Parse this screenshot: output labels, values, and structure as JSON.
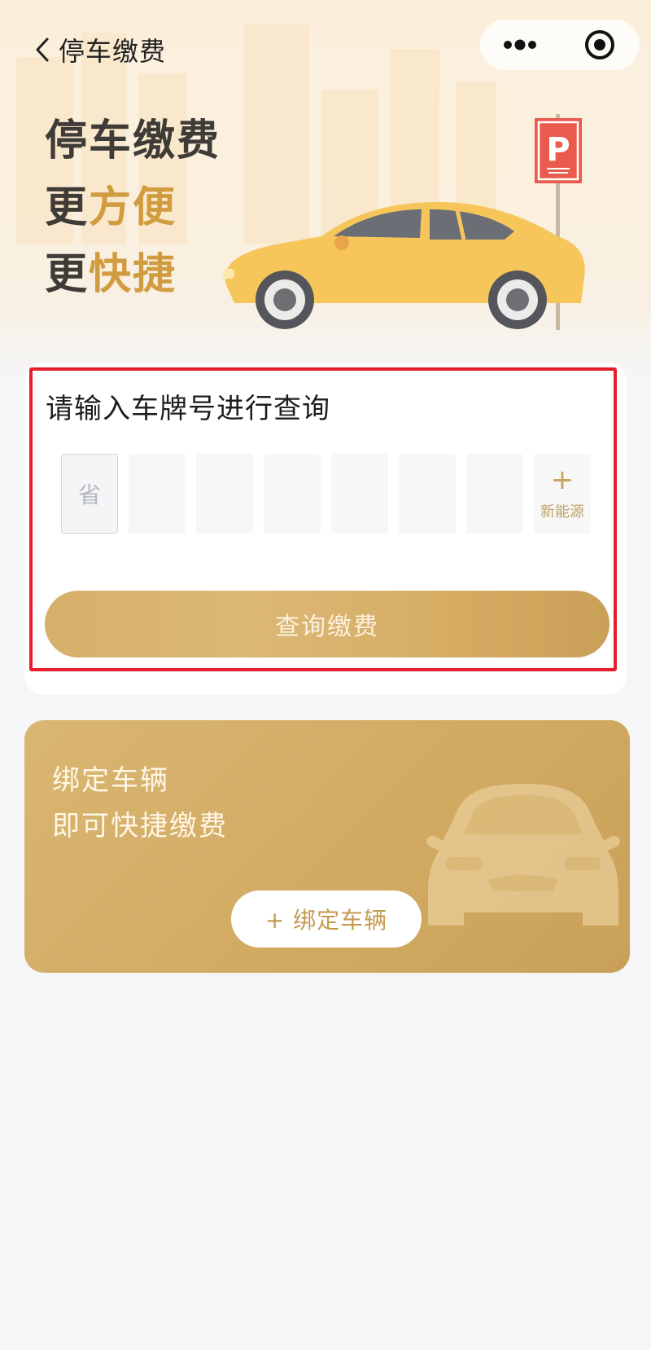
{
  "header": {
    "title": "停车缴费"
  },
  "capsule": {
    "more_icon": "more-dots-icon",
    "close_icon": "miniprogram-close-icon"
  },
  "hero": {
    "line1": "停车缴费",
    "line2_plain": "更",
    "line2_accent": "方便",
    "line3_plain": "更",
    "line3_accent": "快捷",
    "sign_letter": "P",
    "colors": {
      "accent": "#d19c3f",
      "text": "#3f3b36",
      "car": "#f6c65a",
      "sign": "#ea5a4d"
    }
  },
  "query": {
    "title": "请输入车牌号进行查询",
    "province_placeholder": "省",
    "plate_slots": [
      "",
      "",
      "",
      "",
      "",
      ""
    ],
    "new_energy_plus": "+",
    "new_energy_label": "新能源",
    "button_label": "查询缴费",
    "highlight_color": "#e41e2b"
  },
  "bind": {
    "line1": "绑定车辆",
    "line2": "即可快捷缴费",
    "button_label": "+ 绑定车辆",
    "colors": {
      "card": "#d4ac65",
      "button_text": "#c49a4f"
    }
  }
}
